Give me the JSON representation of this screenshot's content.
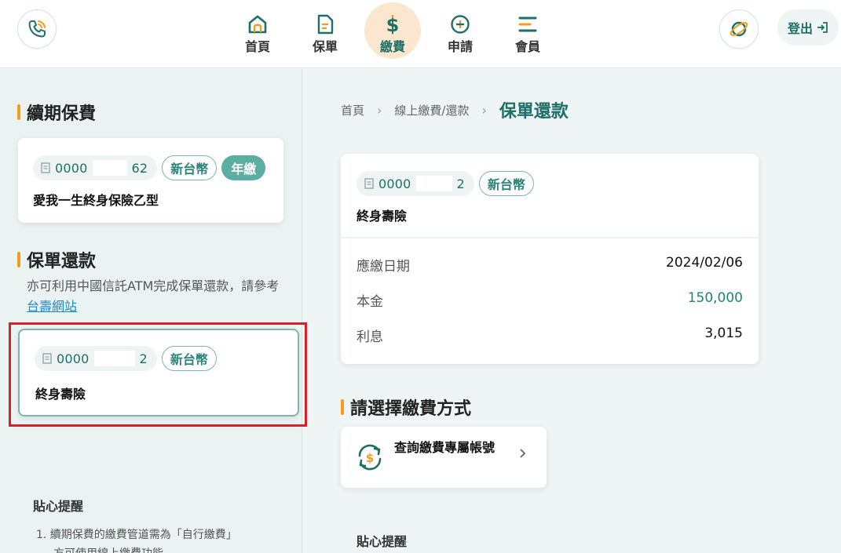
{
  "nav": {
    "items": [
      {
        "label": "首頁",
        "icon": "home-icon"
      },
      {
        "label": "保單",
        "icon": "policy-icon"
      },
      {
        "label": "繳費",
        "icon": "dollar-icon",
        "active": true
      },
      {
        "label": "申請",
        "icon": "plus-circle-icon"
      },
      {
        "label": "會員",
        "icon": "menu-icon"
      }
    ],
    "logout_label": "登出"
  },
  "sidebar": {
    "renewal_title": "續期保費",
    "renewal_card": {
      "policy_prefix": "0000",
      "policy_suffix": "62",
      "currency_tag": "新台幣",
      "freq_tag": "年繳",
      "name": "愛我一生終身保險乙型"
    },
    "loan_title": "保單還款",
    "loan_note_text": "亦可利用中國信託ATM完成保單還款，請參考",
    "loan_note_link": "台壽網站",
    "loan_card": {
      "policy_prefix": "0000",
      "policy_suffix": "2",
      "currency_tag": "新台幣",
      "name": "終身壽險"
    },
    "tips_title": "貼心提醒",
    "tips_item_1_line1": "1.  續期保費的繳費管道需為「自行繳費」",
    "tips_item_1_line2": "方可使用線上繳費功能。"
  },
  "main": {
    "breadcrumb": {
      "home": "首頁",
      "section": "線上繳費/還款",
      "current": "保單還款"
    },
    "detail_card": {
      "policy_prefix": "0000",
      "policy_suffix": "2",
      "currency_tag": "新台幣",
      "name": "終身壽險",
      "due_date_label": "應繳日期",
      "due_date_value": "2024/02/06",
      "principal_label": "本金",
      "principal_value": "150,000",
      "interest_label": "利息",
      "interest_value": "3,015"
    },
    "pay_title": "請選擇繳費方式",
    "pay_method_label": "查詢繳費專屬帳號",
    "tips_title": "貼心提醒"
  },
  "colors": {
    "brand": "#1e6f66",
    "accent": "#f39a1f",
    "highlight": "#d9202a"
  }
}
